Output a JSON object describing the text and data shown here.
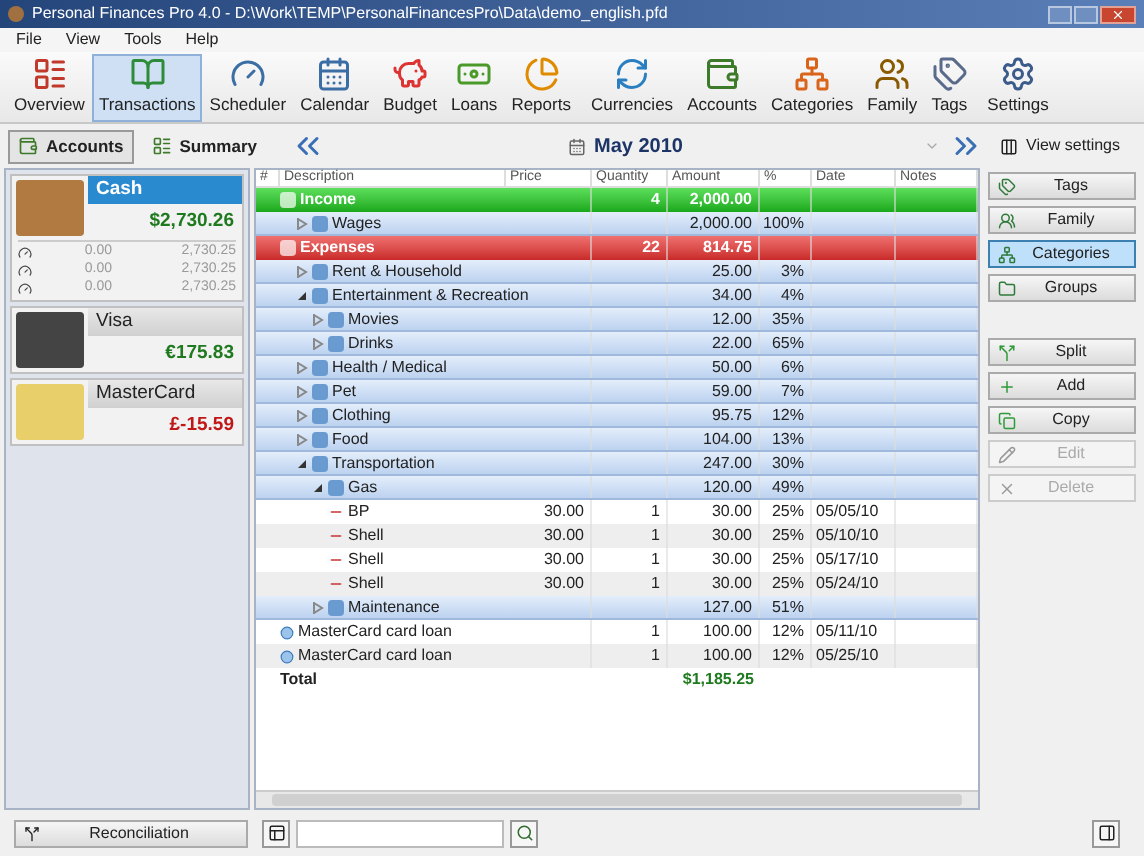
{
  "window": {
    "title": "Personal Finances Pro 4.0 - D:\\Work\\TEMP\\PersonalFinancesPro\\Data\\demo_english.pfd"
  },
  "menu": [
    "File",
    "View",
    "Tools",
    "Help"
  ],
  "toolbar": [
    {
      "label": "Overview",
      "selected": false
    },
    {
      "label": "Transactions",
      "selected": true
    },
    {
      "label": "Scheduler",
      "selected": false
    },
    {
      "label": "Calendar",
      "selected": false
    },
    {
      "label": "Budget",
      "selected": false
    },
    {
      "label": "Loans",
      "selected": false
    },
    {
      "label": "Reports",
      "selected": false
    },
    {
      "label": "Currencies",
      "selected": false
    },
    {
      "label": "Accounts",
      "selected": false
    },
    {
      "label": "Categories",
      "selected": false
    },
    {
      "label": "Family",
      "selected": false
    },
    {
      "label": "Tags",
      "selected": false
    },
    {
      "label": "Settings",
      "selected": false
    }
  ],
  "panel_tabs": [
    {
      "label": "Accounts",
      "selected": true
    },
    {
      "label": "Summary",
      "selected": false
    }
  ],
  "period": "May 2010",
  "view_settings": "View settings",
  "accounts": [
    {
      "name": "Cash",
      "balance": "$2,730.26",
      "negative": false,
      "selected": true,
      "details": [
        [
          "0.00",
          "2,730.25"
        ],
        [
          "0.00",
          "2,730.25"
        ],
        [
          "0.00",
          "2,730.25"
        ]
      ]
    },
    {
      "name": "Visa",
      "balance": "€175.83",
      "negative": false,
      "selected": false
    },
    {
      "name": "MasterCard",
      "balance": "£-15.59",
      "negative": true,
      "selected": false
    }
  ],
  "table": {
    "columns": [
      "#",
      "Description",
      "Price",
      "Quantity",
      "Amount",
      "%",
      "Date",
      "Notes"
    ],
    "rows": [
      {
        "kind": "income",
        "description": "Income",
        "quantity": "4",
        "amount": "2,000.00",
        "children": [
          {
            "kind": "category",
            "expanded": false,
            "description": "Wages",
            "amount": "2,000.00",
            "percent": "100%"
          }
        ]
      },
      {
        "kind": "expense",
        "description": "Expenses",
        "quantity": "22",
        "amount": "814.75",
        "children": [
          {
            "kind": "category",
            "expanded": false,
            "description": "Rent & Household",
            "amount": "25.00",
            "percent": "3%"
          },
          {
            "kind": "category",
            "expanded": true,
            "description": "Entertainment & Recreation",
            "amount": "34.00",
            "percent": "4%",
            "children": [
              {
                "kind": "category",
                "expanded": false,
                "description": "Movies",
                "amount": "12.00",
                "percent": "35%"
              },
              {
                "kind": "category",
                "expanded": false,
                "description": "Drinks",
                "amount": "22.00",
                "percent": "65%"
              }
            ]
          },
          {
            "kind": "category",
            "expanded": false,
            "description": "Health / Medical",
            "amount": "50.00",
            "percent": "6%"
          },
          {
            "kind": "category",
            "expanded": false,
            "description": "Pet",
            "amount": "59.00",
            "percent": "7%"
          },
          {
            "kind": "category",
            "expanded": false,
            "description": "Clothing",
            "amount": "95.75",
            "percent": "12%"
          },
          {
            "kind": "category",
            "expanded": false,
            "description": "Food",
            "amount": "104.00",
            "percent": "13%"
          },
          {
            "kind": "category",
            "expanded": true,
            "description": "Transportation",
            "amount": "247.00",
            "percent": "30%",
            "children": [
              {
                "kind": "category",
                "expanded": true,
                "description": "Gas",
                "amount": "120.00",
                "percent": "49%",
                "children": [
                  {
                    "kind": "transaction",
                    "description": "BP",
                    "price": "30.00",
                    "quantity": "1",
                    "amount": "30.00",
                    "percent": "25%",
                    "date": "05/05/10"
                  },
                  {
                    "kind": "transaction",
                    "description": "Shell",
                    "price": "30.00",
                    "quantity": "1",
                    "amount": "30.00",
                    "percent": "25%",
                    "date": "05/10/10"
                  },
                  {
                    "kind": "transaction",
                    "description": "Shell",
                    "price": "30.00",
                    "quantity": "1",
                    "amount": "30.00",
                    "percent": "25%",
                    "date": "05/17/10"
                  },
                  {
                    "kind": "transaction",
                    "description": "Shell",
                    "price": "30.00",
                    "quantity": "1",
                    "amount": "30.00",
                    "percent": "25%",
                    "date": "05/24/10"
                  }
                ]
              },
              {
                "kind": "category",
                "expanded": false,
                "description": "Maintenance",
                "amount": "127.00",
                "percent": "51%"
              }
            ]
          }
        ]
      },
      {
        "kind": "loan",
        "description": "MasterCard card loan",
        "quantity": "1",
        "amount": "100.00",
        "percent": "12%",
        "date": "05/11/10"
      },
      {
        "kind": "loan",
        "description": "MasterCard card loan",
        "quantity": "1",
        "amount": "100.00",
        "percent": "12%",
        "date": "05/25/10"
      }
    ],
    "total_label": "Total",
    "total": "$1,185.25"
  },
  "side_buttons": [
    {
      "label": "Tags",
      "selected": false,
      "disabled": false
    },
    {
      "label": "Family",
      "selected": false,
      "disabled": false
    },
    {
      "label": "Categories",
      "selected": true,
      "disabled": false
    },
    {
      "label": "Groups",
      "selected": false,
      "disabled": false
    }
  ],
  "action_buttons": [
    {
      "label": "Split",
      "disabled": false
    },
    {
      "label": "Add",
      "disabled": false
    },
    {
      "label": "Copy",
      "disabled": false
    },
    {
      "label": "Edit",
      "disabled": true
    },
    {
      "label": "Delete",
      "disabled": true
    }
  ],
  "reconciliation": "Reconciliation"
}
